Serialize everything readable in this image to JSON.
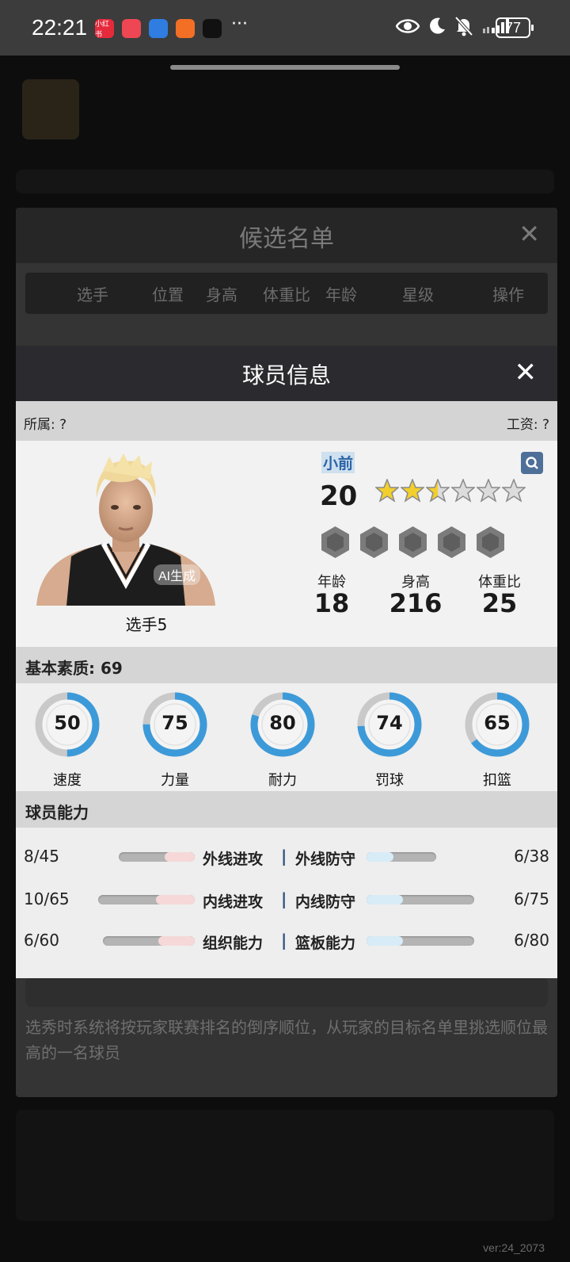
{
  "status_bar": {
    "time": "22:21",
    "apps": [
      {
        "name": "xiaohongshu-icon",
        "label": "小红书",
        "color": "#e52a3c"
      },
      {
        "name": "app-red-icon",
        "label": "",
        "color": "#ef4654"
      },
      {
        "name": "browser-icon",
        "label": "",
        "color": "#2f7de1"
      },
      {
        "name": "send-icon",
        "label": "",
        "color": "#f26f25"
      },
      {
        "name": "capcut-icon",
        "label": "",
        "color": "#111111"
      }
    ],
    "more": "···",
    "battery": "77"
  },
  "candidate_list": {
    "title": "候选名单",
    "close": "✕",
    "columns": [
      "选手",
      "位置",
      "身高",
      "体重比",
      "年龄",
      "星级",
      "操作"
    ],
    "rule_text": "选秀时系统将按玩家联赛排名的倒序顺位，从玩家的目标名单里挑选顺位最高的一名球员"
  },
  "player_info": {
    "title": "球员信息",
    "close": "✕",
    "team_label": "所属: ?",
    "salary_label": "工资: ?",
    "ai_tag": "AI生成",
    "player_name": "选手5",
    "position": "小前",
    "rating": "20",
    "stars_filled": 2.5,
    "stars_total": 6,
    "bio": [
      {
        "label": "年龄",
        "value": "18"
      },
      {
        "label": "身高",
        "value": "216"
      },
      {
        "label": "体重比",
        "value": "25"
      }
    ],
    "base_quality_title": "基本素质: 69",
    "attributes": [
      {
        "label": "速度",
        "value": "50",
        "pct": 0.5
      },
      {
        "label": "力量",
        "value": "75",
        "pct": 0.75
      },
      {
        "label": "耐力",
        "value": "80",
        "pct": 0.8
      },
      {
        "label": "罚球",
        "value": "74",
        "pct": 0.74
      },
      {
        "label": "扣篮",
        "value": "65",
        "pct": 0.65
      }
    ],
    "ability_title": "球员能力",
    "abilities": [
      {
        "left_value": "8/45",
        "left_label": "外线进攻",
        "left_ratio": 0.18,
        "right_label": "外线防守",
        "right_value": "6/38",
        "right_ratio": 0.16
      },
      {
        "left_value": "10/65",
        "left_label": "内线进攻",
        "left_ratio": 0.15,
        "right_label": "内线防守",
        "right_value": "6/75",
        "right_ratio": 0.08
      },
      {
        "left_value": "6/60",
        "left_label": "组织能力",
        "left_ratio": 0.1,
        "right_label": "篮板能力",
        "right_value": "6/80",
        "right_ratio": 0.08
      }
    ]
  },
  "version": "ver:24_2073",
  "colors": {
    "ring_fill": "#3d9ad9",
    "ring_track": "#c9c9c9",
    "star": "#f2cf2d"
  }
}
